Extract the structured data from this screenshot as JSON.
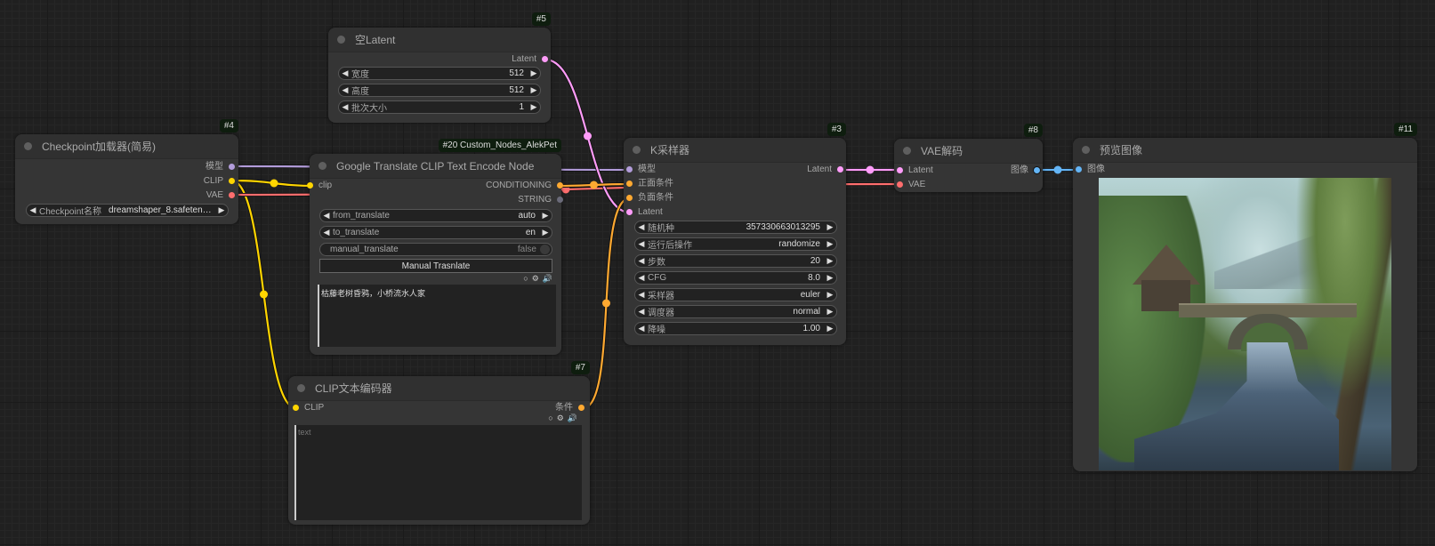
{
  "canvas": {
    "links": [
      {
        "from": "checkpoint.model",
        "to": "ksampler.model",
        "color": "#b39ddb"
      },
      {
        "from": "checkpoint.clip",
        "to": "google_translate.clip",
        "color": "#ffd500"
      },
      {
        "from": "checkpoint.clip",
        "to": "clip_encoder.clip",
        "color": "#ffd500"
      },
      {
        "from": "checkpoint.vae",
        "to": "vae_decode.vae",
        "color": "#ff6e6e"
      },
      {
        "from": "empty_latent.latent",
        "to": "ksampler.latent",
        "color": "#ff9cf9"
      },
      {
        "from": "google_translate.conditioning",
        "to": "ksampler.positive",
        "color": "#ffa931"
      },
      {
        "from": "clip_encoder.conditioning",
        "to": "ksampler.negative",
        "color": "#ffa931"
      },
      {
        "from": "ksampler.latent",
        "to": "vae_decode.latent",
        "color": "#ff9cf9"
      },
      {
        "from": "vae_decode.image",
        "to": "preview.image",
        "color": "#64b5f6"
      }
    ]
  },
  "nodes": {
    "checkpoint": {
      "id": "#4",
      "title": "Checkpoint加载器(简易)",
      "outputs": [
        {
          "label": "模型",
          "color": "#b39ddb"
        },
        {
          "label": "CLIP",
          "color": "#ffd500"
        },
        {
          "label": "VAE",
          "color": "#ff6e6e"
        }
      ],
      "widgets": [
        {
          "label": "Checkpoint名称",
          "value": "dreamshaper_8.safeten…"
        }
      ]
    },
    "empty_latent": {
      "id": "#5",
      "title": "空Latent",
      "outputs": [
        {
          "label": "Latent",
          "color": "#ff9cf9"
        }
      ],
      "widgets": [
        {
          "label": "宽度",
          "value": "512"
        },
        {
          "label": "高度",
          "value": "512"
        },
        {
          "label": "批次大小",
          "value": "1"
        }
      ]
    },
    "google_translate": {
      "id": "#20 Custom_Nodes_AlekPet",
      "title": "Google Translate CLIP Text Encode Node",
      "inputs": [
        {
          "label": "clip",
          "color": "#ffd500"
        }
      ],
      "outputs": [
        {
          "label": "CONDITIONING",
          "color": "#ffa931"
        },
        {
          "label": "STRING",
          "color": "#6b6b7a"
        }
      ],
      "widgets": [
        {
          "label": "from_translate",
          "value": "auto"
        },
        {
          "label": "to_translate",
          "value": "en"
        }
      ],
      "toggle": {
        "label": "manual_translate",
        "value": "false"
      },
      "button": "Manual Trasnlate",
      "text": "枯藤老树昏鸦，小桥流水人家",
      "icons": [
        "circle-icon",
        "gear-icon",
        "speaker-icon"
      ]
    },
    "clip_encoder": {
      "id": "#7",
      "title": "CLIP文本编码器",
      "inputs": [
        {
          "label": "CLIP",
          "color": "#ffd500"
        }
      ],
      "outputs": [
        {
          "label": "条件",
          "color": "#ffa931"
        }
      ],
      "text": "",
      "placeholder": "text",
      "icons": [
        "circle-icon",
        "gear-icon",
        "speaker-icon"
      ]
    },
    "ksampler": {
      "id": "#3",
      "title": "K采样器",
      "inputs": [
        {
          "label": "模型",
          "color": "#b39ddb"
        },
        {
          "label": "正面条件",
          "color": "#ffa931"
        },
        {
          "label": "负面条件",
          "color": "#ffa931"
        },
        {
          "label": "Latent",
          "color": "#ff9cf9"
        }
      ],
      "outputs": [
        {
          "label": "Latent",
          "color": "#ff9cf9"
        }
      ],
      "widgets": [
        {
          "label": "随机种",
          "value": "357330663013295"
        },
        {
          "label": "运行后操作",
          "value": "randomize"
        },
        {
          "label": "步数",
          "value": "20"
        },
        {
          "label": "CFG",
          "value": "8.0"
        },
        {
          "label": "采样器",
          "value": "euler"
        },
        {
          "label": "调度器",
          "value": "normal"
        },
        {
          "label": "降噪",
          "value": "1.00"
        }
      ]
    },
    "vae_decode": {
      "id": "#8",
      "title": "VAE解码",
      "inputs": [
        {
          "label": "Latent",
          "color": "#ff9cf9"
        },
        {
          "label": "VAE",
          "color": "#ff6e6e"
        }
      ],
      "outputs": [
        {
          "label": "图像",
          "color": "#64b5f6"
        }
      ]
    },
    "preview": {
      "id": "#11",
      "title": "预览图像",
      "inputs": [
        {
          "label": "图像",
          "color": "#64b5f6"
        }
      ],
      "image_alt": "Painting of a wooden cottage beside an arched stone bridge over a stream, with a large twisted tree and misty mountains"
    }
  }
}
